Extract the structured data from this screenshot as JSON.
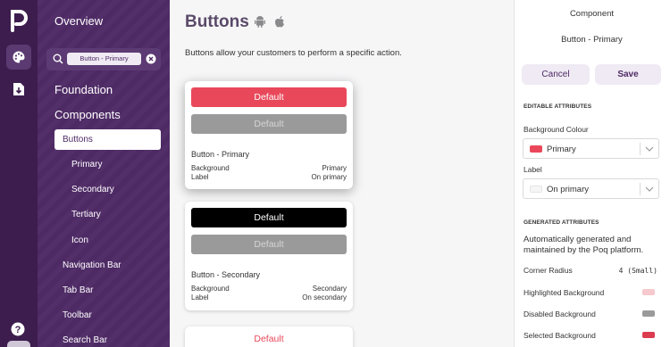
{
  "nav": {
    "search_chip": "Button - Primary",
    "items": {
      "overview": "Overview",
      "foundation": "Foundation",
      "components": "Components",
      "buttons": "Buttons",
      "primary": "Primary",
      "secondary": "Secondary",
      "tertiary": "Tertiary",
      "icon": "Icon",
      "navigation_bar": "Navigation Bar",
      "tab_bar": "Tab Bar",
      "toolbar": "Toolbar",
      "search_bar": "Search Bar"
    }
  },
  "main": {
    "title": "Buttons",
    "description": "Buttons allow your customers to perform a specific action.",
    "cards": [
      {
        "name": "Button - Primary",
        "button_label": "Default",
        "disabled_label": "Default",
        "attr1_label": "Background",
        "attr1_value": "Primary",
        "attr2_label": "Label",
        "attr2_value": "On primary"
      },
      {
        "name": "Button - Secondary",
        "button_label": "Default",
        "disabled_label": "Default",
        "attr1_label": "Background",
        "attr1_value": "Secondary",
        "attr2_label": "Label",
        "attr2_value": "On secondary"
      },
      {
        "button_label": "Default"
      }
    ]
  },
  "panel": {
    "header": "Component",
    "component_name": "Button - Primary",
    "cancel_label": "Cancel",
    "save_label": "Save",
    "editable_title": "EDITABLE ATTRIBUTES",
    "bg_colour_label": "Background Colour",
    "bg_colour_value": "Primary",
    "label_label": "Label",
    "label_value": "On primary",
    "generated_title": "GENERATED ATTRIBUTES",
    "generated_text": "Automatically generated and maintained by the Poq platform.",
    "corner_radius_label": "Corner Radius",
    "corner_radius_value": "4 (Small)",
    "highlighted_bg_label": "Highlighted Background",
    "disabled_bg_label": "Disabled Background",
    "selected_bg_label": "Selected Background"
  },
  "colors": {
    "brand_purple": "#4e2a65",
    "rail_purple": "#3c1d4e",
    "primary_red": "#e9485a",
    "secondary_black": "#000000",
    "disabled_grey": "#9a9a9a",
    "highlighted_pink": "#f5c9cd",
    "selected_red": "#dc3c50",
    "on_primary_swatch": "#f6f6f6"
  },
  "icons": [
    "poq-logo-icon",
    "palette-icon",
    "import-icon",
    "help-icon",
    "search-icon",
    "clear-icon",
    "android-icon",
    "apple-icon",
    "chevron-down-icon"
  ]
}
